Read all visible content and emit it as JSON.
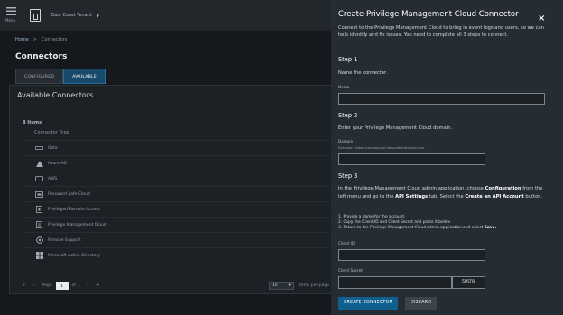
{
  "topbar": {
    "menu_label": "Menu",
    "tenant": "East Coast Tenant",
    "caret": "▼"
  },
  "breadcrumb": {
    "home": "Home",
    "sep": ">",
    "current": "Connectors"
  },
  "page": {
    "title": "Connectors"
  },
  "tabs": [
    {
      "label": "CONFIGURED"
    },
    {
      "label": "AVAILABLE"
    }
  ],
  "panel": {
    "title": "Available Connectors",
    "count": "8 Items",
    "column_header": "Connector Type",
    "rows": [
      {
        "label": "Okta",
        "icon": "okta-icon"
      },
      {
        "label": "Azure AD",
        "icon": "azure-icon"
      },
      {
        "label": "AWS",
        "icon": "aws-icon"
      },
      {
        "label": "Password Safe Cloud",
        "icon": "password-safe-icon"
      },
      {
        "label": "Privileged Remote Access",
        "icon": "remote-access-icon"
      },
      {
        "label": "Privilege Management Cloud",
        "icon": "pm-cloud-icon"
      },
      {
        "label": "Remote Support",
        "icon": "remote-support-icon"
      },
      {
        "label": "Microsoft Active Directory",
        "icon": "windows-icon"
      }
    ],
    "pager": {
      "first": "⇤",
      "prev": "‹",
      "page_label": "Page",
      "page_value": "1",
      "of_label": "of 1",
      "next": "›",
      "last": "⇥",
      "per_page_value": "10",
      "per_page_label": "Items per page"
    }
  },
  "drawer": {
    "title": "Create Privilege Management Cloud Connector",
    "close": "×",
    "intro": "Connect to the Privilege Management Cloud to bring in event logs and users, so we can help identify and fix issues. You need to complete all 3 steps to connect.",
    "step1": {
      "heading": "Step 1",
      "text": "Name the connector.",
      "label": "Name"
    },
    "step2": {
      "heading": "Step 2",
      "text": "Enter your Privilege Management Cloud domain.",
      "label": "Domain",
      "example": "Example: https://company.pm.beyondtrustcloud.com"
    },
    "step3": {
      "heading": "Step 3",
      "p1": "In the Privilege Management Cloud admin application, choose",
      "b1": "Configuration",
      "p2": "from the left menu and go to the",
      "b2": "API Settings",
      "p3": "tab. Select the",
      "b3": "Create an API Account",
      "p4": "button.",
      "l1": "1. Provide a name for the account.",
      "l2": "2. Copy the Client ID and Client Secret and paste it below.",
      "l3": "3. Return to the Privilege Management Cloud admin application and select",
      "l3b": "Save.",
      "client_id": "Client ID",
      "client_secret": "Client Secret",
      "show": "SHOW"
    },
    "create": "CREATE CONNECTOR",
    "discard": "DISCARD"
  }
}
